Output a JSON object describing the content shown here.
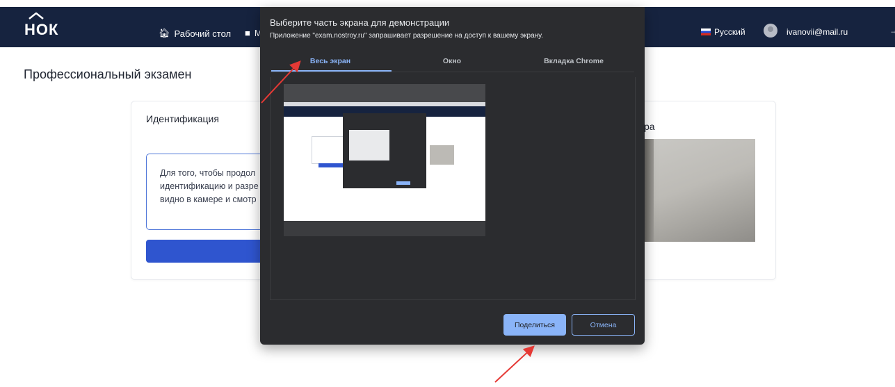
{
  "app": {
    "logo_text": "НОК"
  },
  "nav": {
    "items": [
      {
        "label": "Рабочий стол",
        "icon": "home-icon"
      },
      {
        "label": "М",
        "icon": "document-icon"
      }
    ],
    "language": "Русский",
    "user_email": "ivanovii@mail.ru"
  },
  "page": {
    "title": "Профессиональный экзамен",
    "card_heading": "Идентификация",
    "info_text": "Для того, чтобы продол\nидентификацию и разре\nвидно в камере и смотр",
    "camera_heading": "ра"
  },
  "dialog": {
    "title": "Выберите часть экрана для демонстрации",
    "subtitle": "Приложение \"exam.nostroy.ru\" запрашивает разрешение на доступ к вашему экрану.",
    "tabs": [
      "Весь экран",
      "Окно",
      "Вкладка Chrome"
    ],
    "active_tab": "Весь экран",
    "share_label": "Поделиться",
    "cancel_label": "Отмена"
  },
  "colors": {
    "navbar": "#16233f",
    "dialog_bg": "#2b2c2f",
    "accent": "#8ab4f8",
    "primary_button": "#2f55cf",
    "annotation_arrow": "#e53935"
  }
}
